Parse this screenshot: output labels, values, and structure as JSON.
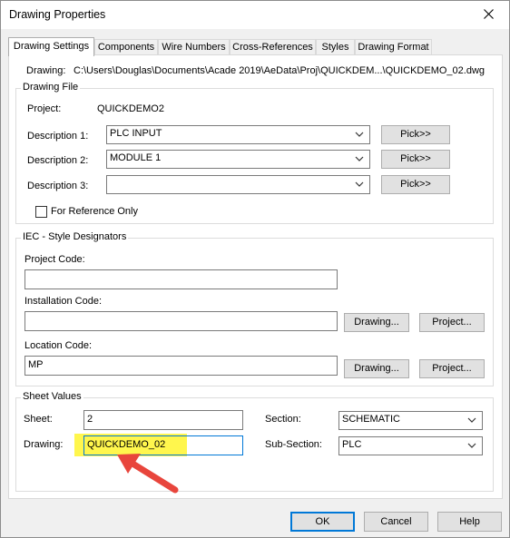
{
  "window": {
    "title": "Drawing Properties"
  },
  "tabs": [
    {
      "label": "Drawing Settings"
    },
    {
      "label": "Components"
    },
    {
      "label": "Wire Numbers"
    },
    {
      "label": "Cross-References"
    },
    {
      "label": "Styles"
    },
    {
      "label": "Drawing Format"
    }
  ],
  "drawing": {
    "label": "Drawing:",
    "path": "C:\\Users\\Douglas\\Documents\\Acade 2019\\AeData\\Proj\\QUICKDEM...\\QUICKDEMO_02.dwg"
  },
  "drawing_file": {
    "group_label": "Drawing File",
    "project_label": "Project:",
    "project_value": "QUICKDEMO2",
    "descriptions": [
      {
        "label": "Description 1:",
        "value": "PLC INPUT",
        "pick": "Pick>>"
      },
      {
        "label": "Description 2:",
        "value": "MODULE 1",
        "pick": "Pick>>"
      },
      {
        "label": "Description 3:",
        "value": "",
        "pick": "Pick>>"
      }
    ],
    "reference_only_label": "For Reference Only"
  },
  "iec": {
    "group_label": "IEC - Style Designators",
    "project_code_label": "Project Code:",
    "project_code_value": "",
    "installation_code_label": "Installation Code:",
    "installation_code_value": "",
    "location_code_label": "Location Code:",
    "location_code_value": "MP",
    "drawing_button": "Drawing...",
    "project_button": "Project..."
  },
  "sheet_values": {
    "group_label": "Sheet Values",
    "sheet_label": "Sheet:",
    "sheet_value": "2",
    "drawing_label": "Drawing:",
    "drawing_value": "QUICKDEMO_02",
    "section_label": "Section:",
    "section_value": "SCHEMATIC",
    "subsection_label": "Sub-Section:",
    "subsection_value": "PLC"
  },
  "footer": {
    "ok": "OK",
    "cancel": "Cancel",
    "help": "Help"
  },
  "colors": {
    "accent": "#0078d7",
    "highlight": "#fff64d",
    "arrow": "#e8453c"
  }
}
